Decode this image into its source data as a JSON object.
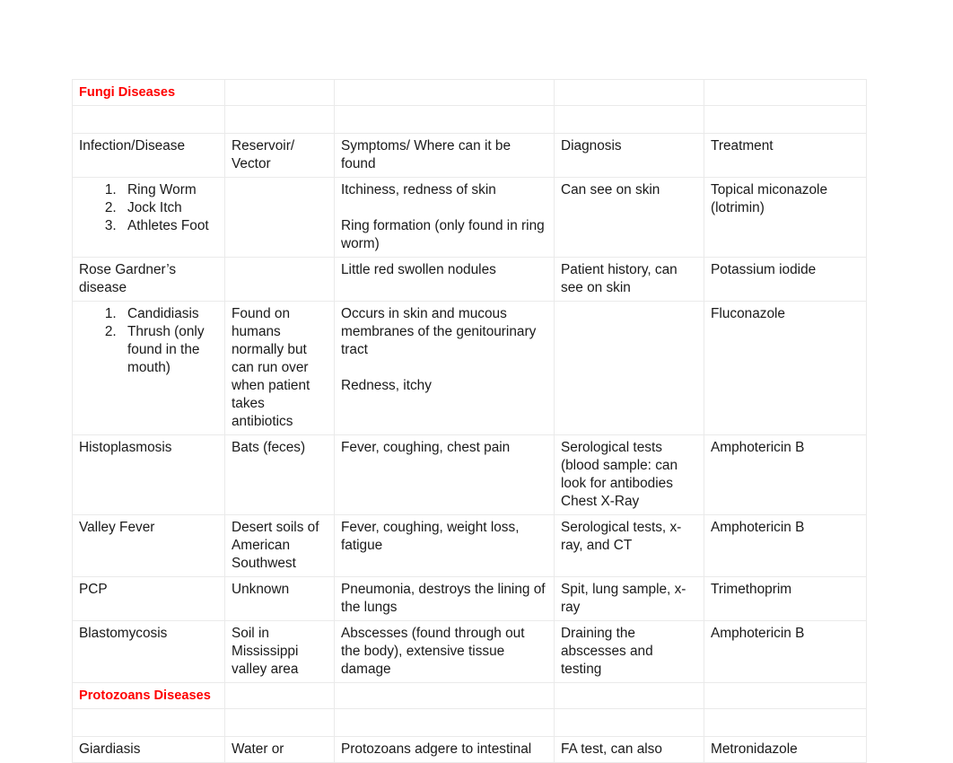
{
  "document": {
    "accent_color": "#FF0000",
    "text_color": "#1a1a1a",
    "border_color": "#eaeaea",
    "sections": {
      "fungi_heading": "Fungi Diseases",
      "protozoans_heading": "Protozoans Diseases"
    }
  },
  "table": {
    "headers": {
      "col0": "Infection/Disease",
      "col1": "Reservoir/ Vector",
      "col1_line1": "Reservoir/",
      "col1_line2": "Vector",
      "col2": "Symptoms/ Where can it be found",
      "col3": "Diagnosis",
      "col4": "Treatment"
    },
    "rows": {
      "ringworm": {
        "disease_list": [
          "Ring Worm",
          "Jock Itch",
          "Athletes Foot"
        ],
        "reservoir": "",
        "symptoms_1": "Itchiness, redness of skin",
        "symptoms_2": "Ring formation (only found in ring worm)",
        "diagnosis": "Can see on skin",
        "treatment": "Topical miconazole (lotrimin)"
      },
      "rose_gardner": {
        "disease": "Rose Gardner’s disease",
        "reservoir": "",
        "symptoms": "Little red swollen nodules",
        "diagnosis": "Patient history, can see on skin",
        "treatment": "Potassium iodide"
      },
      "candidiasis": {
        "disease_list": [
          "Candidiasis",
          "Thrush (only found in the mouth)"
        ],
        "reservoir": "Found on humans normally but can run over when patient takes antibiotics",
        "symptoms_1": "Occurs in skin and mucous membranes of the genitourinary tract",
        "symptoms_2": "Redness, itchy",
        "diagnosis": "",
        "treatment": "Fluconazole"
      },
      "histoplasmosis": {
        "disease": "Histoplasmosis",
        "reservoir": "Bats (feces)",
        "symptoms": "Fever, coughing, chest pain",
        "diagnosis_1": "Serological tests (blood sample: can look for antibodies",
        "diagnosis_2": "Chest X-Ray",
        "treatment": "Amphotericin B"
      },
      "valley_fever": {
        "disease": "Valley Fever",
        "reservoir": "Desert soils of American Southwest",
        "symptoms": "Fever, coughing, weight loss, fatigue",
        "diagnosis": "Serological tests, x-ray, and CT",
        "treatment": "Amphotericin B"
      },
      "pcp": {
        "disease": "PCP",
        "reservoir": "Unknown",
        "symptoms": "Pneumonia, destroys the lining of the lungs",
        "diagnosis": "Spit, lung sample, x-ray",
        "treatment": "Trimethoprim"
      },
      "blastomycosis": {
        "disease": "Blastomycosis",
        "reservoir": "Soil in Mississippi valley area",
        "symptoms": "Abscesses (found through out the body), extensive tissue damage",
        "diagnosis": "Draining the abscesses and testing",
        "treatment": "Amphotericin B"
      },
      "giardiasis": {
        "disease": "Giardiasis",
        "reservoir": "Water or",
        "symptoms": "Protozoans adgere to intestinal",
        "diagnosis": "FA test, can also",
        "treatment": "Metronidazole"
      }
    }
  }
}
